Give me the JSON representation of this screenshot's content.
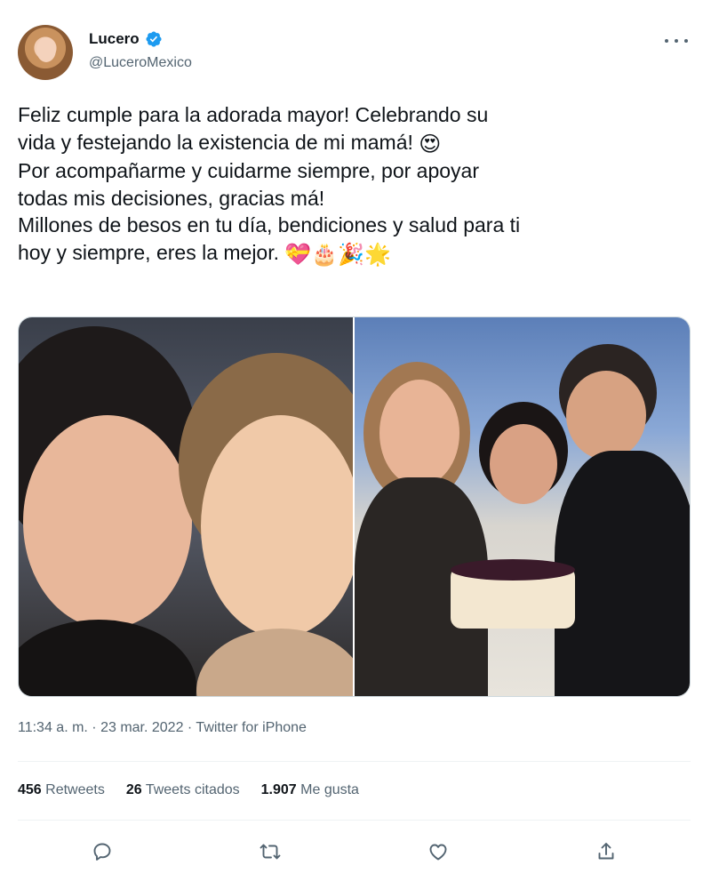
{
  "user": {
    "name": "Lucero",
    "handle": "@LuceroMexico",
    "verified": true
  },
  "tweet": {
    "lines": [
      "Feliz cumple para la adorada mayor! Celebrando su",
      "vida y festejando la existencia de mi mamá!",
      "Por acompañarme y cuidarme siempre, por apoyar",
      "todas mis decisiones, gracias má!",
      "Millones de besos en tu día, bendiciones y salud para ti",
      "hoy y siempre, eres la mejor."
    ],
    "emoji_line2": "😍",
    "emoji_line6": [
      "💝",
      "🎂",
      "🎉",
      "🌟"
    ]
  },
  "meta": {
    "time": "11:34 a. m.",
    "date": "23 mar. 2022",
    "source": "Twitter for iPhone"
  },
  "stats": {
    "retweets_count": "456",
    "retweets_label": "Retweets",
    "quotes_count": "26",
    "quotes_label": "Tweets citados",
    "likes_count": "1.907",
    "likes_label": "Me gusta"
  },
  "icons": {
    "verified": "verified-badge-icon",
    "more": "more-icon",
    "reply": "reply-icon",
    "retweet": "retweet-icon",
    "like": "like-icon",
    "share": "share-icon"
  },
  "colors": {
    "text": "#0f1419",
    "secondary": "#536471",
    "verified": "#1d9bf0",
    "border": "#eff3f4"
  }
}
